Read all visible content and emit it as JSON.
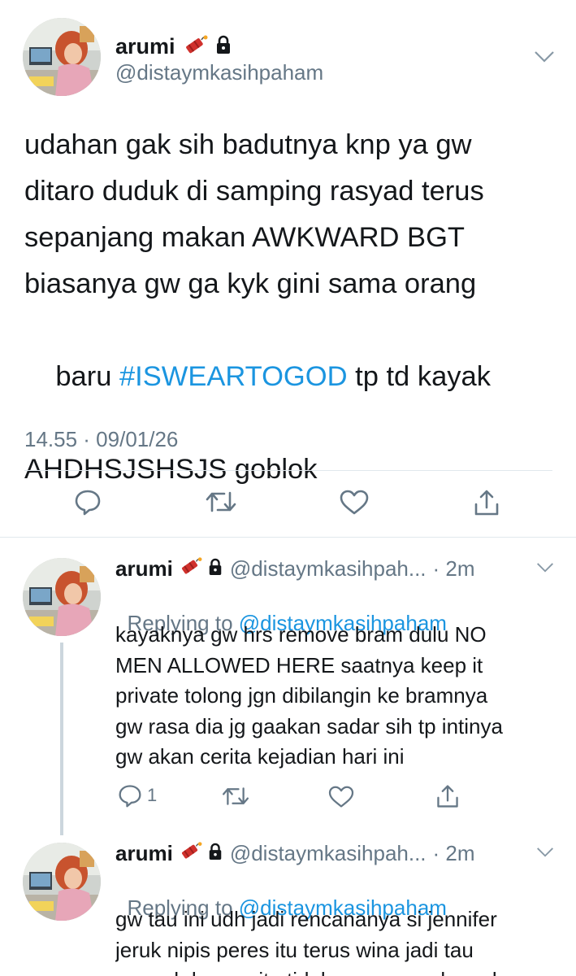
{
  "main_tweet": {
    "name": "arumi",
    "name_emoji": "dynamite-icon",
    "handle": "@distaymkasihpaham",
    "text_lines": [
      "udahan gak sih badutnya knp ya gw",
      "ditaro duduk di samping rasyad terus",
      "sepanjang makan AWKWARD BGT",
      "biasanya gw ga kyk gini sama orang"
    ],
    "line5_prefix": "baru ",
    "hashtag": "#ISWEARTOGOD",
    "line5_suffix": " tp td kayak",
    "line6": "AHDHSJSHSJS goblok",
    "timestamp": "14.55 · 09/01/26"
  },
  "reply1": {
    "name": "arumi",
    "handle": "@distaymkasihpah...",
    "time": "· 2m",
    "replying_prefix": "Replying to ",
    "replying_handle": "@distaymkasihpaham",
    "text_lines": [
      "kayaknya gw hrs remove bram dulu NO",
      "MEN ALLOWED HERE saatnya keep it",
      "private tolong jgn dibilangin ke bramnya",
      "gw rasa dia jg gaakan sadar sih tp intinya",
      "gw akan cerita kejadian hari ini"
    ],
    "reply_count": "1"
  },
  "reply2": {
    "name": "arumi",
    "handle": "@distaymkasihpah...",
    "time": "· 2m",
    "replying_prefix": "Replying to ",
    "replying_handle": "@distaymkasihpaham",
    "text_lines": [
      "gw tau ini udh jadi rencananya si jennifer",
      "jeruk nipis peres itu terus wina jadi tau",
      "rasyad dan gw itu tidak nyaman selama bersama di"
    ]
  },
  "colors": {
    "link": "#1b95e0",
    "muted": "#657786",
    "divider": "#e1e8ed",
    "text": "#14171a"
  }
}
